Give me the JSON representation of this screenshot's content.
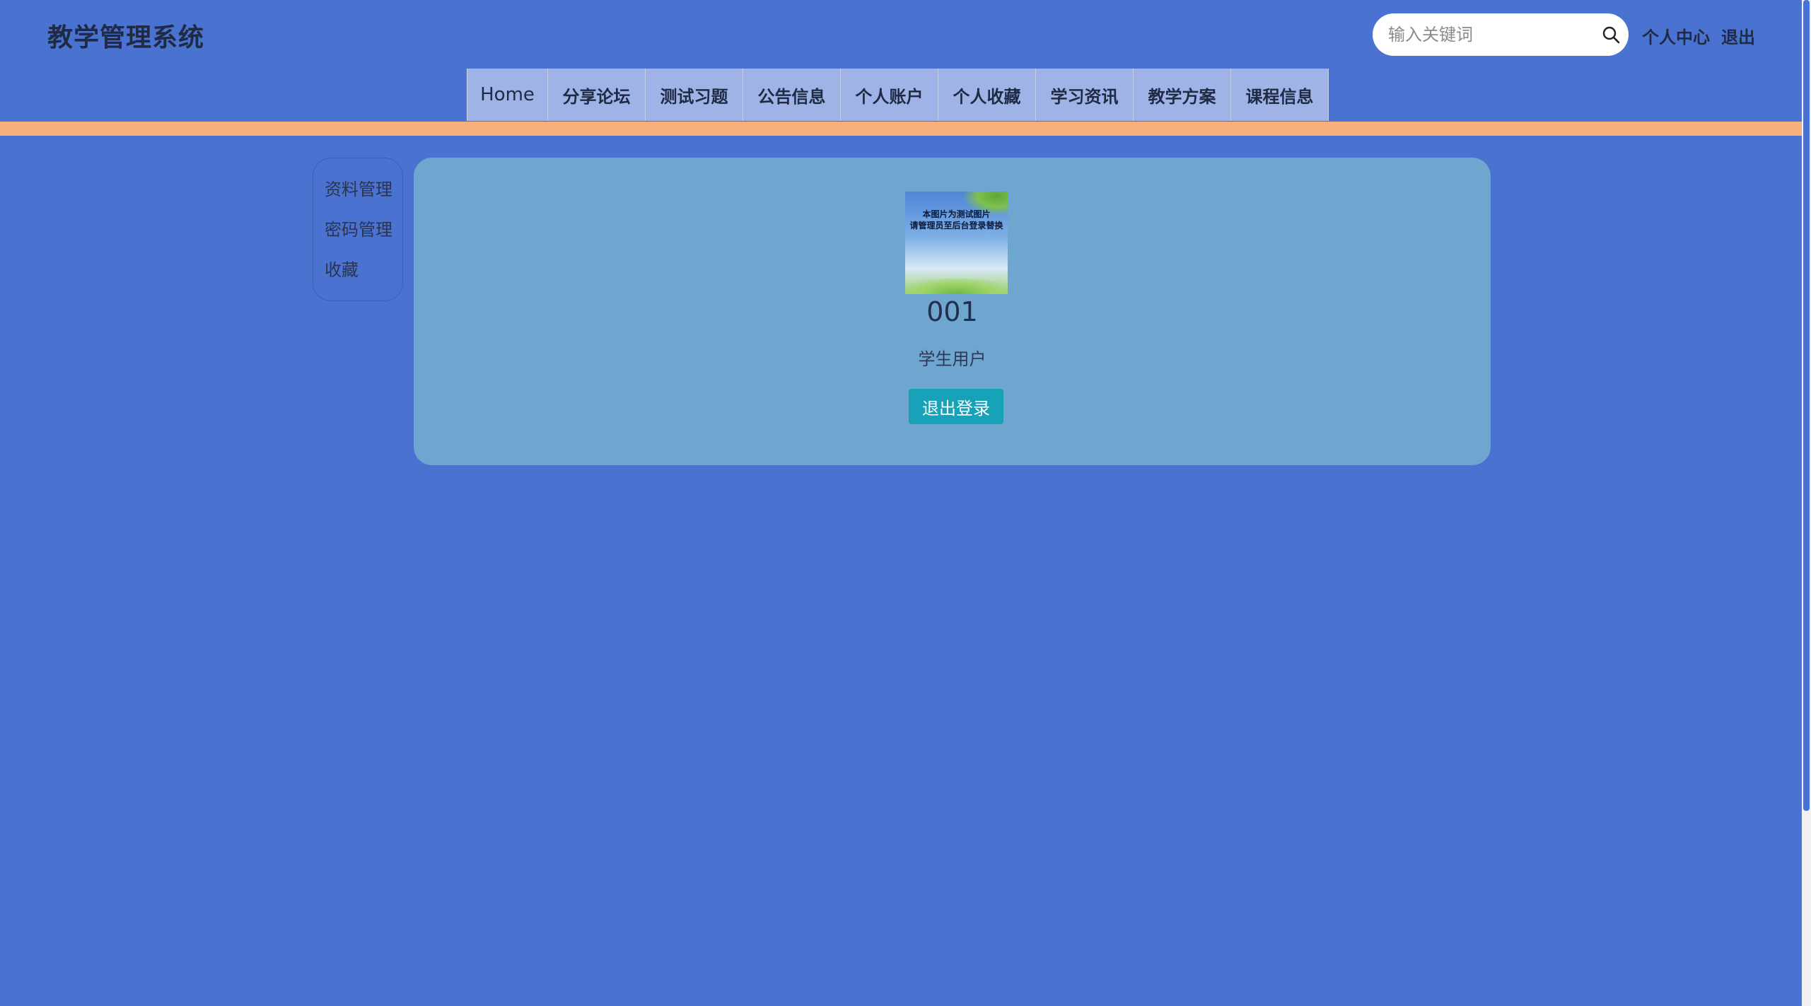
{
  "header": {
    "title": "教学管理系统",
    "search_placeholder": "输入关键词",
    "links": [
      "个人中心",
      "退出"
    ]
  },
  "nav": {
    "items": [
      "Home",
      "分享论坛",
      "测试习题",
      "公告信息",
      "个人账户",
      "个人收藏",
      "学习资讯",
      "教学方案",
      "课程信息"
    ]
  },
  "sidebar": {
    "items": [
      "资料管理",
      "密码管理",
      "收藏"
    ]
  },
  "profile": {
    "avatar_text": "本图片为测试图片\n请管理员至后台登录替换",
    "username": "001",
    "role": "学生用户",
    "logout_label": "退出登录"
  },
  "colors": {
    "background": "#4a72d1",
    "nav_bg": "#9fb3e6",
    "accent_bar": "#f7b07b",
    "card_bg": "#6fa6cf",
    "button": "#17a2b8"
  }
}
